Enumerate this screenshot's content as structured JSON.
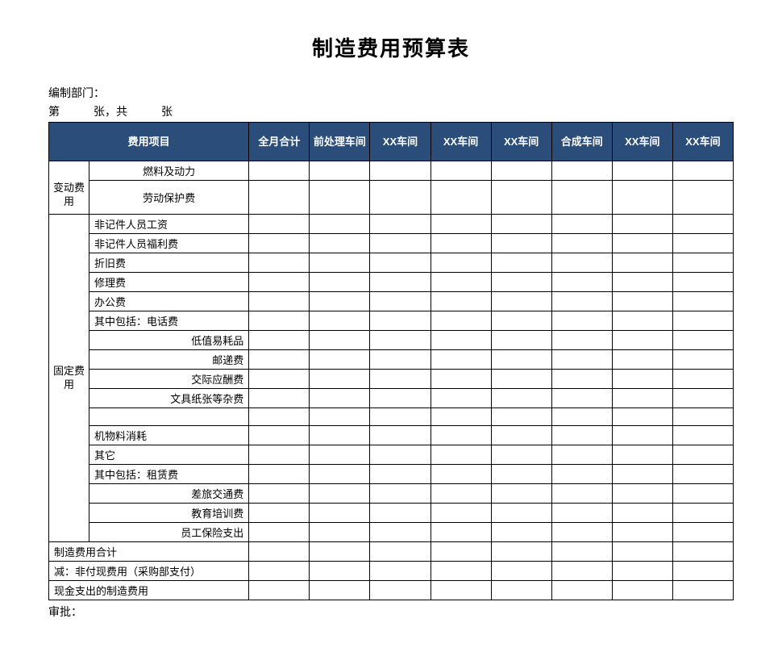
{
  "title": "制造费用预算表",
  "meta": {
    "dept_label": "编制部门：",
    "page_line": "第　　　张，共　　　张"
  },
  "header": {
    "item": "费用项目",
    "cols": [
      "全月合计",
      "前处理车间",
      "XX车间",
      "XX车间",
      "XX车间",
      "合成车间",
      "XX车间",
      "XX车间"
    ]
  },
  "categories": {
    "variable": "变动费用",
    "fixed": "固定费用"
  },
  "rows": {
    "fuel": "燃料及动力",
    "labor_protect": "劳动保护费",
    "non_piece_wage": "非记件人员工资",
    "non_piece_welfare": "非记件人员福利费",
    "depreciation": "折旧费",
    "repair": "修理费",
    "office": "办公费",
    "inc_phone": "其中包括：电话费",
    "low_value": "低值易耗品",
    "postage": "邮递费",
    "entertain": "交际应酬费",
    "stationery": "文具纸张等杂费",
    "spacer": "",
    "material_consume": "机物料消耗",
    "other": "其它",
    "inc_rent": "其中包括：租赁费",
    "travel": "差旅交通费",
    "training": "教育培训费",
    "insurance": "员工保险支出"
  },
  "totals": {
    "mfg_total": "制造费用合计",
    "less_noncash": "减：非付现费用（采购部支付）",
    "cash_out": "现金支出的制造费用"
  },
  "footer": {
    "approve": "审批："
  },
  "chart_data": {
    "type": "table",
    "title": "制造费用预算表",
    "columns": [
      "费用项目",
      "全月合计",
      "前处理车间",
      "XX车间",
      "XX车间",
      "XX车间",
      "合成车间",
      "XX车间",
      "XX车间"
    ],
    "row_labels": [
      "燃料及动力",
      "劳动保护费",
      "非记件人员工资",
      "非记件人员福利费",
      "折旧费",
      "修理费",
      "办公费",
      "其中包括：电话费",
      "低值易耗品",
      "邮递费",
      "交际应酬费",
      "文具纸张等杂费",
      "",
      "机物料消耗",
      "其它",
      "其中包括：租赁费",
      "差旅交通费",
      "教育培训费",
      "员工保险支出",
      "制造费用合计",
      "减：非付现费用（采购部支付）",
      "现金支出的制造费用"
    ],
    "values": "blank"
  }
}
